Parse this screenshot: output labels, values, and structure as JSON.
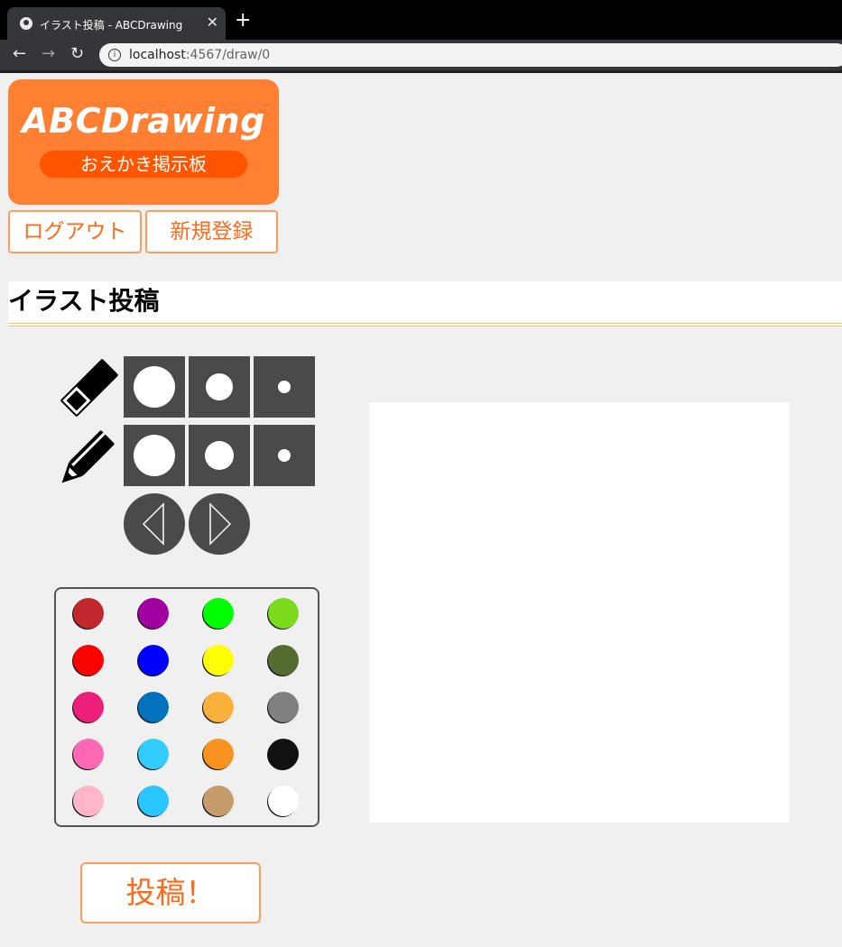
{
  "browser": {
    "tab_title": "イラスト投稿 - ABCDrawing",
    "tab_close": "✕",
    "new_tab": "+",
    "back": "←",
    "forward": "→",
    "reload": "↻",
    "url_host": "localhost",
    "url_path": ":4567/draw/0",
    "info_icon": "i"
  },
  "logo": {
    "title": "ABCDrawing",
    "subtitle": "おえかき掲示板"
  },
  "nav": {
    "logout": "ログアウト",
    "register": "新規登録"
  },
  "page": {
    "heading": "イラスト投稿"
  },
  "tools": {
    "eraser_icon": "eraser-icon",
    "pencil_icon": "pencil-icon",
    "sizes": [
      "large",
      "medium",
      "small"
    ],
    "undo_icon": "triangle-left-icon",
    "redo_icon": "triangle-right-icon"
  },
  "palette": {
    "colors": [
      [
        "#c1272d",
        "#a000a0",
        "#00ff00",
        "#7cdb1f"
      ],
      [
        "#ff0000",
        "#0000ff",
        "#ffff00",
        "#556b2f"
      ],
      [
        "#ed1e79",
        "#0071bc",
        "#fbb03b",
        "#808080"
      ],
      [
        "#ff69b4",
        "#33ccff",
        "#f7931e",
        "#111111"
      ],
      [
        "#ffb6c8",
        "#29c5ff",
        "#c69c6d",
        "#ffffff"
      ]
    ]
  },
  "submit": {
    "label": "投稿！"
  }
}
